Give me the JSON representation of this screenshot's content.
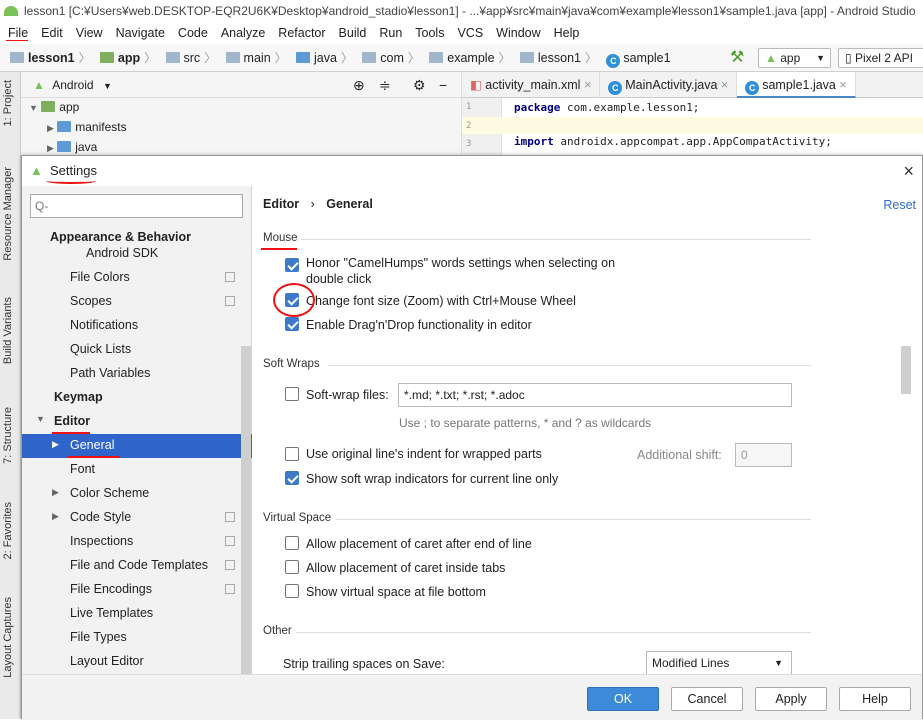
{
  "window": {
    "title": "lesson1 [C:¥Users¥web.DESKTOP-EQR2U6K¥Desktop¥android_stadio¥lesson1] - ...¥app¥src¥main¥java¥com¥example¥lesson1¥sample1.java [app] - Android Studio"
  },
  "menu": [
    "File",
    "Edit",
    "View",
    "Navigate",
    "Code",
    "Analyze",
    "Refactor",
    "Build",
    "Run",
    "Tools",
    "VCS",
    "Window",
    "Help"
  ],
  "breadcrumbs": [
    "lesson1",
    "app",
    "src",
    "main",
    "java",
    "com",
    "example",
    "lesson1",
    "sample1"
  ],
  "toolbar": {
    "run_config": "app",
    "device": "Pixel 2 API"
  },
  "side_tools": {
    "project": "1: Project",
    "resource_manager": "Resource Manager",
    "build_variants": "Build Variants",
    "structure": "7: Structure",
    "favorites": "2: Favorites",
    "layout_captures": "Layout Captures"
  },
  "project_panel": {
    "view": "Android",
    "items": [
      "app",
      "manifests",
      "java"
    ]
  },
  "editor": {
    "tabs": [
      "activity_main.xml",
      "MainActivity.java",
      "sample1.java"
    ],
    "lines": [
      {
        "num": "1",
        "kw": "package",
        "rest": " com.example.lesson1;"
      },
      {
        "num": "2",
        "kw": "",
        "rest": ""
      },
      {
        "num": "3",
        "kw": "import",
        "rest": " androidx.appcompat.app.AppCompatActivity;"
      }
    ]
  },
  "settings": {
    "title": "Settings",
    "search_placeholder": "Q-",
    "tree": {
      "appearance": "Appearance & Behavior",
      "android_sdk": "Android SDK",
      "file_colors": "File Colors",
      "scopes": "Scopes",
      "notifications": "Notifications",
      "quick_lists": "Quick Lists",
      "path_variables": "Path Variables",
      "keymap": "Keymap",
      "editor": "Editor",
      "general": "General",
      "font": "Font",
      "color_scheme": "Color Scheme",
      "code_style": "Code Style",
      "inspections": "Inspections",
      "file_code_templates": "File and Code Templates",
      "file_encodings": "File Encodings",
      "live_templates": "Live Templates",
      "file_types": "File Types",
      "layout_editor": "Layout Editor"
    },
    "breadcrumb": {
      "parent": "Editor",
      "sep": "›",
      "current": "General"
    },
    "reset": "Reset",
    "mouse": {
      "title": "Mouse",
      "camelhumps_1": "Honor \"CamelHumps\" words settings when selecting on",
      "camelhumps_2": "double click",
      "camelhumps_checked": true,
      "zoom": "Change font size (Zoom) with Ctrl+Mouse Wheel",
      "zoom_checked": true,
      "dragdrop": "Enable Drag'n'Drop functionality in editor",
      "dragdrop_checked": true
    },
    "soft_wraps": {
      "title": "Soft Wraps",
      "softwrap_label": "Soft-wrap files:",
      "softwrap_checked": false,
      "softwrap_value": "*.md; *.txt; *.rst; *.adoc",
      "hint": "Use ; to separate patterns, * and ? as wildcards",
      "indent": "Use original line's indent for wrapped parts",
      "indent_checked": false,
      "additional_shift_label": "Additional shift:",
      "additional_shift_value": "0",
      "indicators": "Show soft wrap indicators for current line only",
      "indicators_checked": true
    },
    "virtual_space": {
      "title": "Virtual Space",
      "caret_end": "Allow placement of caret after end of line",
      "caret_tabs": "Allow placement of caret inside tabs",
      "file_bottom": "Show virtual space at file bottom"
    },
    "other": {
      "title": "Other",
      "strip_label": "Strip trailing spaces on Save:",
      "strip_value": "Modified Lines"
    },
    "buttons": {
      "ok": "OK",
      "cancel": "Cancel",
      "apply": "Apply",
      "help": "Help"
    }
  }
}
